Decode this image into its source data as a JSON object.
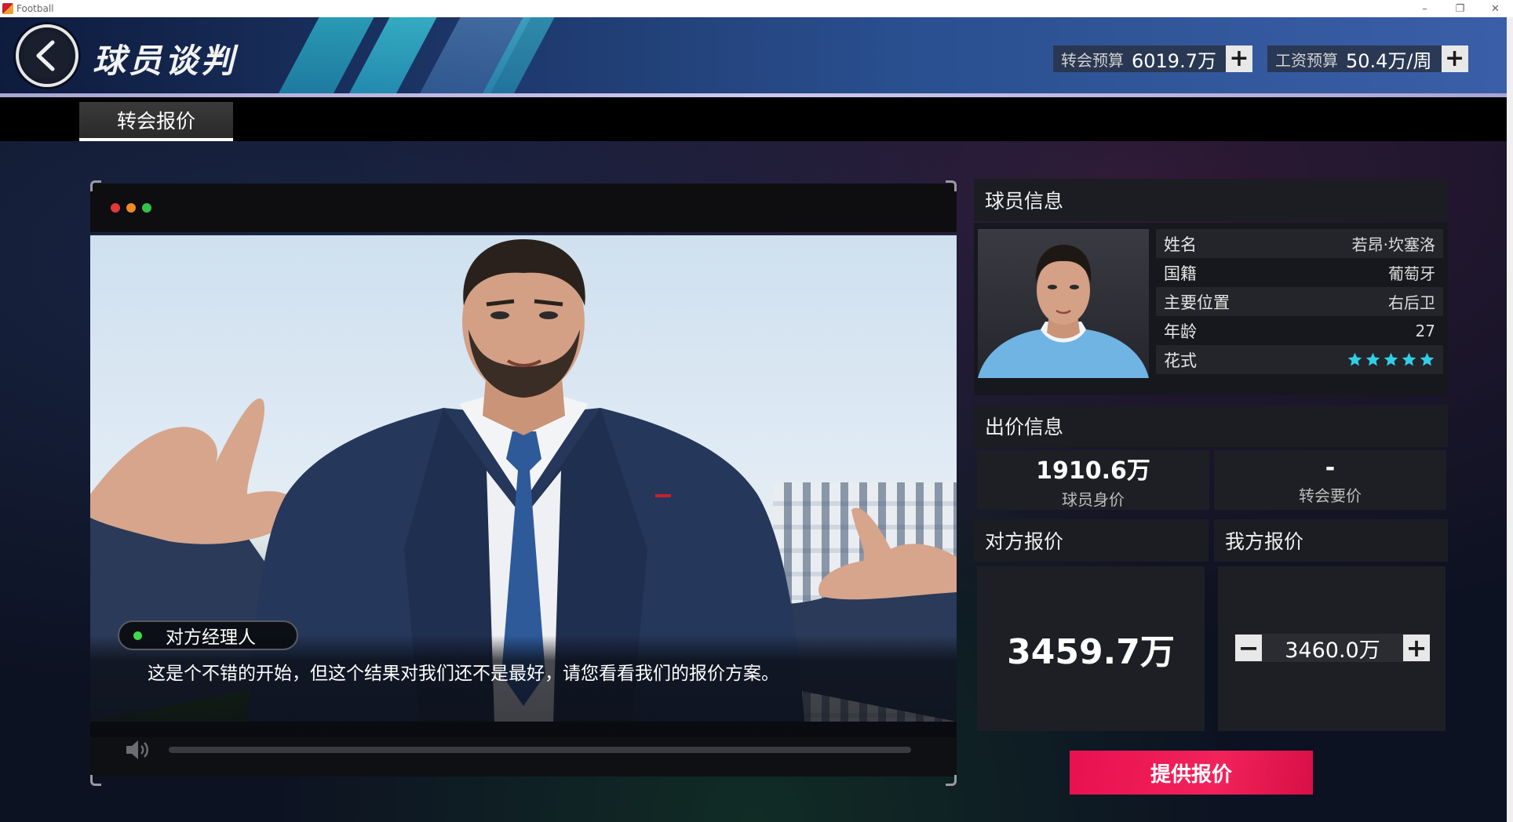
{
  "window": {
    "title": "Football",
    "controls": [
      "–",
      "❐",
      "✕"
    ]
  },
  "header": {
    "title": "球员谈判",
    "transfer_budget": {
      "label": "转会预算",
      "value": "6019.7万"
    },
    "wage_budget": {
      "label": "工资预算",
      "value": "50.4万/周"
    }
  },
  "tabs": [
    {
      "label": "转会报价",
      "active": true
    }
  ],
  "video": {
    "speaker": "对方经理人",
    "subtitle": "这是个不错的开始，但这个结果对我们还不是最好，请您看看我们的报价方案。",
    "progress": 0
  },
  "player_info": {
    "title": "球员信息",
    "rows": [
      {
        "label": "姓名",
        "value": "若昂·坎塞洛"
      },
      {
        "label": "国籍",
        "value": "葡萄牙"
      },
      {
        "label": "主要位置",
        "value": "右后卫"
      },
      {
        "label": "年龄",
        "value": "27"
      },
      {
        "label": "花式",
        "stars": 5
      }
    ]
  },
  "bid_info": {
    "title": "出价信息",
    "player_value": {
      "value": "1910.6万",
      "label": "球员身价"
    },
    "transfer_ask": {
      "value": "-",
      "label": "转会要价"
    }
  },
  "their_offer": {
    "title": "对方报价",
    "value": "3459.7万"
  },
  "our_offer": {
    "title": "我方报价",
    "value": "3460.0万"
  },
  "submit": {
    "label": "提供报价"
  },
  "colors": {
    "accent": "#f2225b",
    "star": "#2fd0e6",
    "live_dot": "#3ddc4a"
  }
}
